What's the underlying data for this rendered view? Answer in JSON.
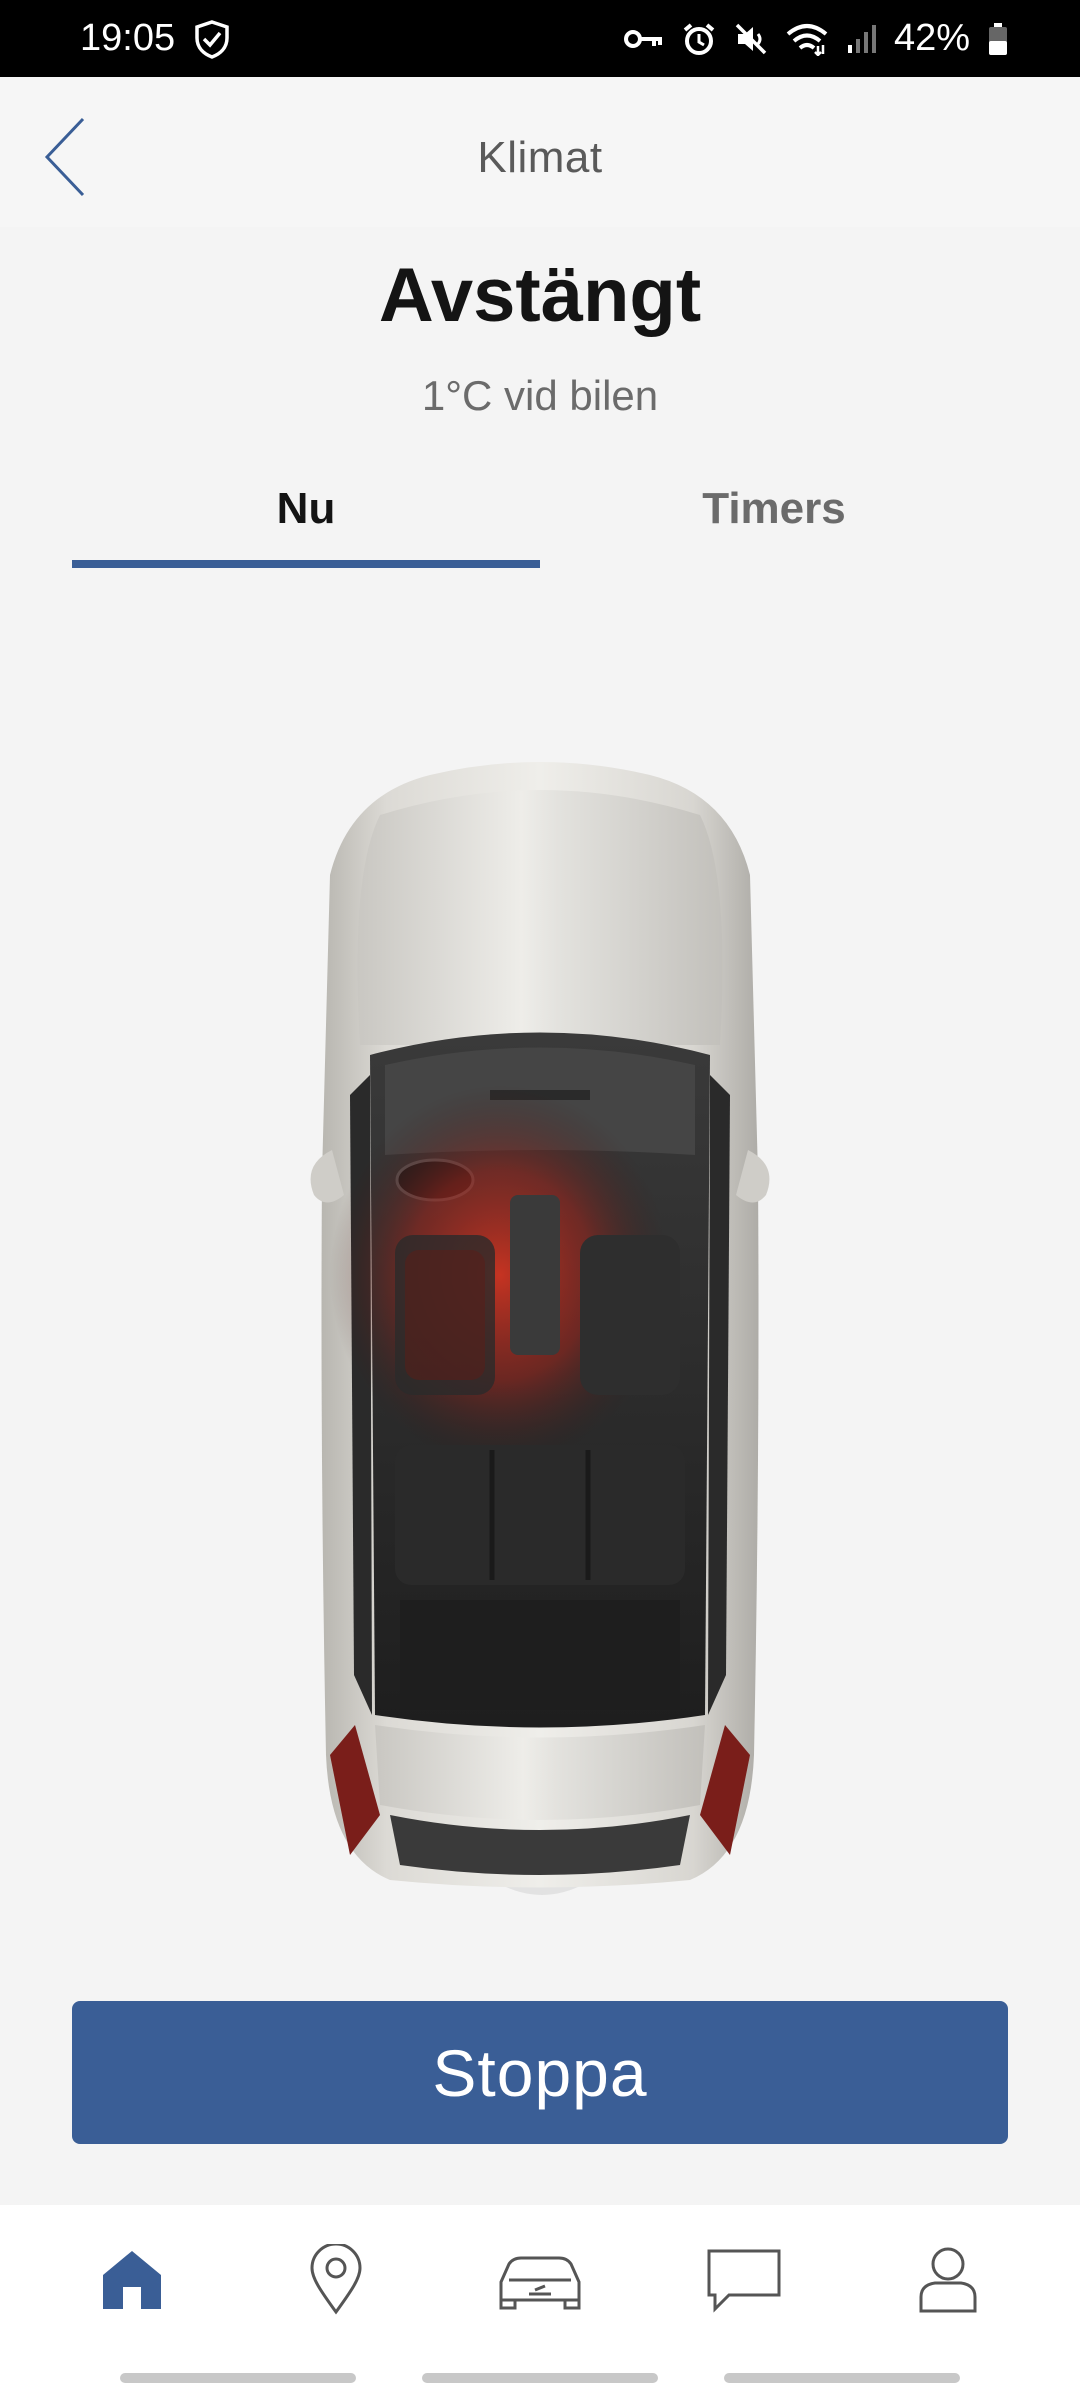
{
  "status_bar": {
    "time": "19:05",
    "battery": "42%",
    "icons": [
      "shield-check-icon",
      "key-icon",
      "alarm-icon",
      "mute-icon",
      "wifi-icon",
      "signal-icon",
      "battery-icon"
    ]
  },
  "header": {
    "title": "Klimat",
    "back_icon": "chevron-left-icon"
  },
  "climate": {
    "state": "Avstängt",
    "temperature_text": "1°C vid bilen"
  },
  "tabs": [
    {
      "label": "Nu",
      "active": true
    },
    {
      "label": "Timers",
      "active": false
    }
  ],
  "action": {
    "label": "Stoppa"
  },
  "bottom_nav": {
    "items": [
      {
        "icon": "home-icon",
        "active": true
      },
      {
        "icon": "location-pin-icon",
        "active": false
      },
      {
        "icon": "car-icon",
        "active": false
      },
      {
        "icon": "chat-icon",
        "active": false
      },
      {
        "icon": "profile-icon",
        "active": false
      }
    ]
  },
  "colors": {
    "accent": "#3a5e96",
    "background": "#f4f4f4",
    "seat_heat": "#c0281e"
  }
}
